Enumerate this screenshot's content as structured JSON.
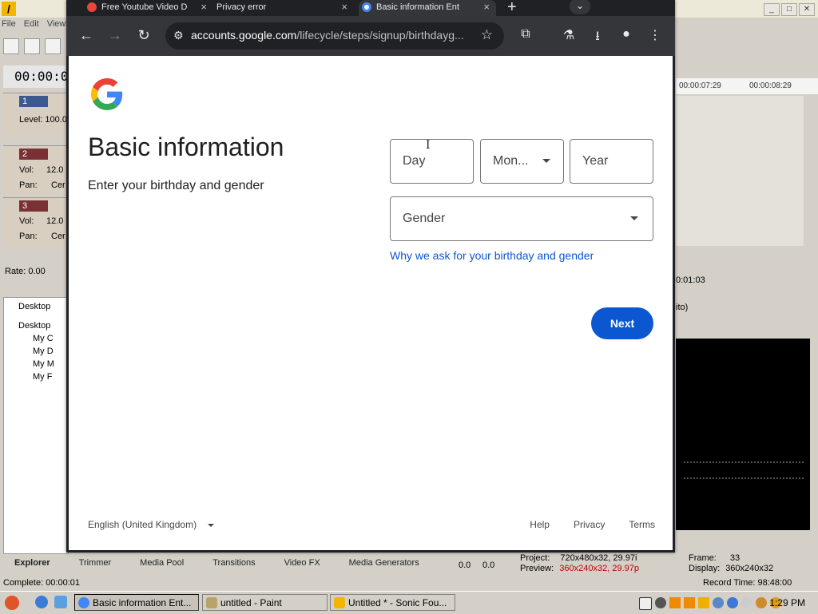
{
  "browser": {
    "tabs": [
      {
        "label": "Free Youtube Video D",
        "favicon_color": "#e8453c"
      },
      {
        "label": "Privacy error",
        "favicon_color": ""
      },
      {
        "label": "Basic information Ent",
        "favicon_color": "#4285f4",
        "active": true
      }
    ],
    "url_host": "accounts.google.com",
    "url_path": "/lifecycle/steps/signup/birthdayg..."
  },
  "page": {
    "heading": "Basic information",
    "subheading": "Enter your birthday and gender",
    "day_placeholder": "Day",
    "month_placeholder": "Mon...",
    "year_placeholder": "Year",
    "gender_placeholder": "Gender",
    "why_link": "Why we ask for your birthday and gender",
    "next_label": "Next",
    "language": "English (United Kingdom)",
    "footer": {
      "help": "Help",
      "privacy": "Privacy",
      "terms": "Terms"
    }
  },
  "background_app": {
    "menu": [
      "File",
      "Edit",
      "View"
    ],
    "timecode": "00:00:0",
    "track1": {
      "num": "1",
      "level": "Level: 100.0"
    },
    "track2": {
      "num": "2",
      "vol": "Vol:",
      "vol_val": "12.0",
      "pan": "Pan:",
      "pan_val": "Cer"
    },
    "track3": {
      "num": "3",
      "vol": "Vol:",
      "vol_val": "12.0",
      "pan": "Pan:",
      "pan_val": "Cer"
    },
    "rate": "Rate: 0.00",
    "explorer": {
      "top": "Desktop",
      "root": "Desktop",
      "items": [
        "My C",
        "My D",
        "My M",
        "My F"
      ]
    },
    "bottom_tabs": [
      "Explorer",
      "Trimmer",
      "Media Pool",
      "Transitions",
      "Video FX",
      "Media Generators"
    ],
    "complete": "Complete: 00:00:01",
    "ruler": [
      "00:00:07:29",
      "00:00:08:29"
    ],
    "time_right": "0:01:03",
    "auto_label": "ito)",
    "project_label": "Project:",
    "project_val": "720x480x32, 29.97i",
    "preview_label": "Preview:",
    "preview_val": "360x240x32, 29.97p",
    "frame_label": "Frame:",
    "frame_val": "33",
    "display_label": "Display:",
    "display_val": "360x240x32",
    "record_time": "Record Time: 98:48:00",
    "meter_vals": [
      "0.0",
      "0.0"
    ]
  },
  "taskbar": {
    "items": [
      {
        "label": "Basic information Ent...",
        "active": true
      },
      {
        "label": "untitled - Paint",
        "active": false
      },
      {
        "label": "Untitled * - Sonic Fou...",
        "active": false
      }
    ],
    "clock": "1:29 PM"
  }
}
